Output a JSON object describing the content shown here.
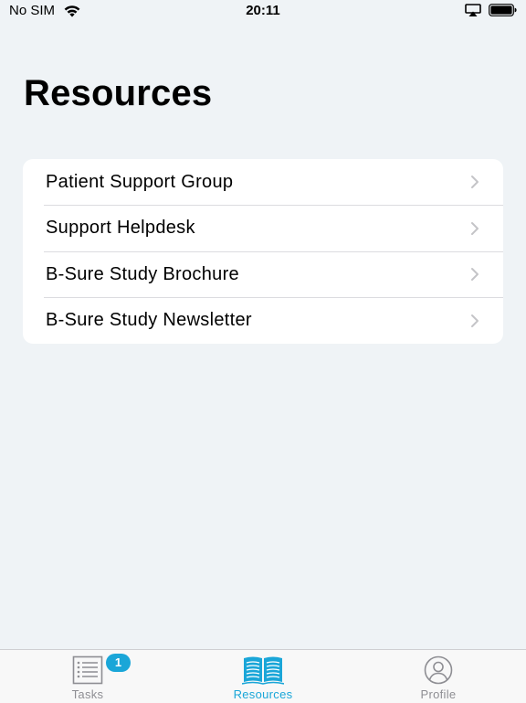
{
  "status_bar": {
    "carrier": "No SIM",
    "time": "20:11",
    "wifi_icon": "wifi-icon",
    "airplay_icon": "airplay-icon",
    "battery_icon": "battery-icon",
    "battery_level": 1.0
  },
  "page": {
    "title": "Resources"
  },
  "resources": {
    "items": [
      {
        "label": "Patient Support Group",
        "icon": "chevron-right-icon"
      },
      {
        "label": "Support Helpdesk",
        "icon": "chevron-right-icon"
      },
      {
        "label": "B-Sure Study Brochure",
        "icon": "chevron-right-icon"
      },
      {
        "label": "B-Sure Study Newsletter",
        "icon": "chevron-right-icon"
      }
    ]
  },
  "tab_bar": {
    "tabs": [
      {
        "label": "Tasks",
        "icon": "task-list-icon",
        "badge": "1",
        "active": false
      },
      {
        "label": "Resources",
        "icon": "open-book-icon",
        "active": true
      },
      {
        "label": "Profile",
        "icon": "profile-icon",
        "active": false
      }
    ]
  },
  "colors": {
    "accent": "#1aa6d8",
    "background": "#eff3f6",
    "inactive_tab": "#8e8e93",
    "chevron": "#c4c4c7"
  }
}
